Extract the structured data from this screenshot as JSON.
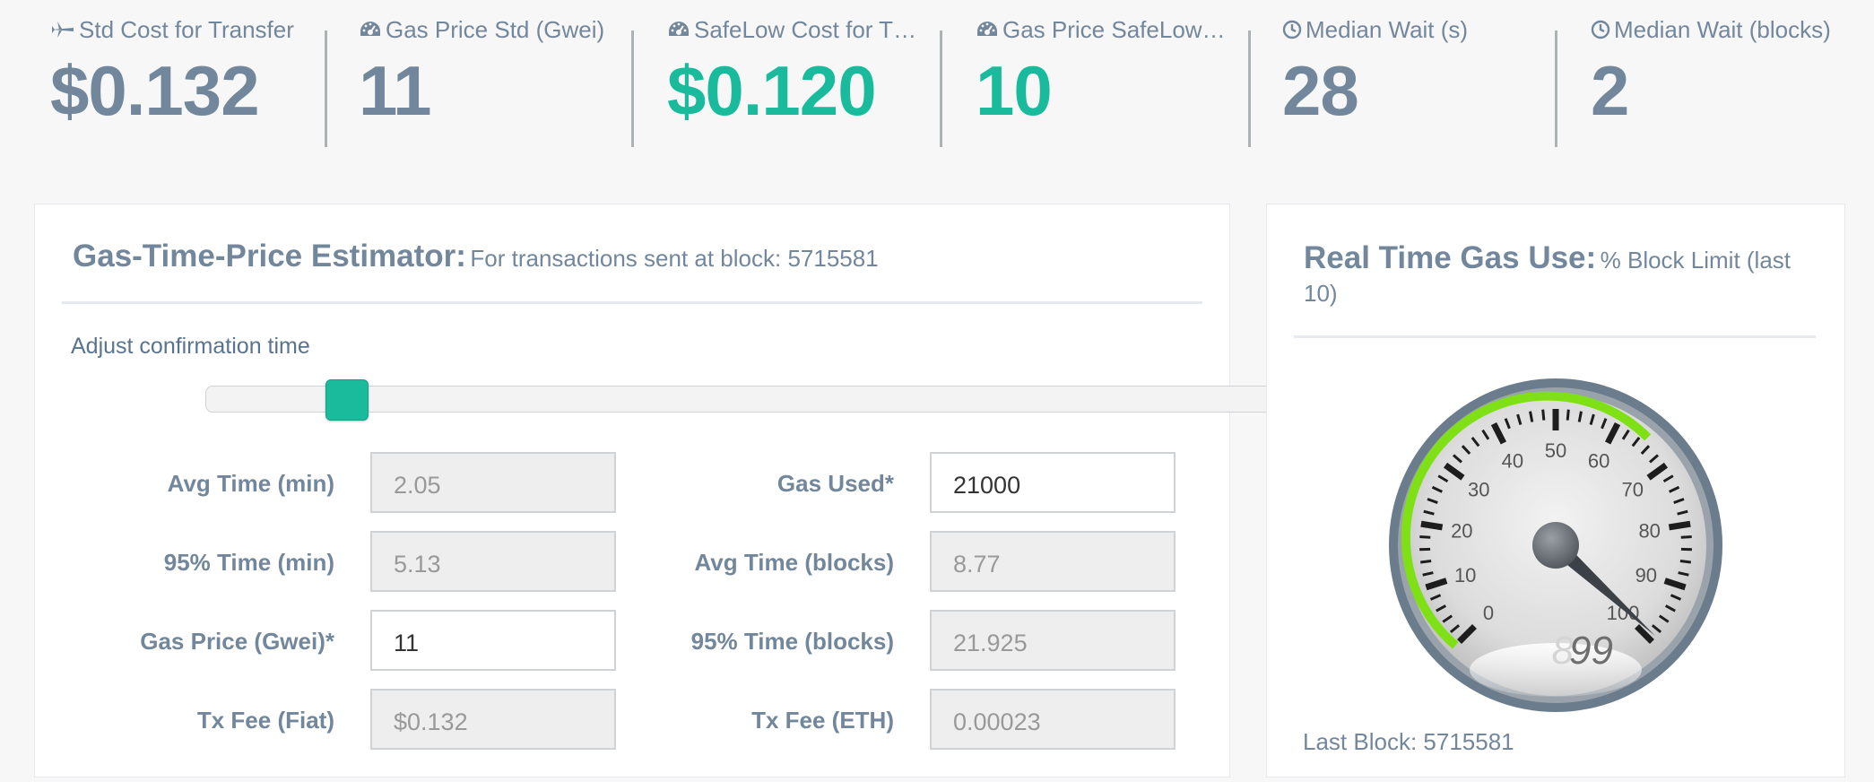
{
  "stats": [
    {
      "icon": "plane-icon",
      "title": "Std Cost for Transfer",
      "value": "$0.132",
      "color": "#73879c"
    },
    {
      "icon": "dashboard-icon",
      "title": "Gas Price Std (Gwei)",
      "value": "11",
      "color": "#73879c"
    },
    {
      "icon": "dashboard-icon",
      "title": "SafeLow Cost for T…",
      "value": "$0.120",
      "color": "#1abb9c"
    },
    {
      "icon": "dashboard-icon",
      "title": "Gas Price SafeLow…",
      "value": "10",
      "color": "#1abb9c"
    },
    {
      "icon": "clock-icon",
      "title": "Median Wait (s)",
      "value": "28",
      "color": "#73879c"
    },
    {
      "icon": "clock-icon",
      "title": "Median Wait (blocks)",
      "value": "2",
      "color": "#73879c"
    }
  ],
  "estimator": {
    "title": "Gas-Time-Price Estimator:",
    "subtitle": "For transactions sent at block: 5715581",
    "adjust_label": "Adjust confirmation time",
    "fields": [
      {
        "label": "Avg Time (min)",
        "value": "2.05",
        "editable": false
      },
      {
        "label": "95% Time (min)",
        "value": "5.13",
        "editable": false
      },
      {
        "label": "Gas Price (Gwei)*",
        "value": "11",
        "editable": true
      },
      {
        "label": "Tx Fee (Fiat)",
        "value": "$0.132",
        "editable": false
      },
      {
        "label": "Gas Used*",
        "value": "21000",
        "editable": true
      },
      {
        "label": "Avg Time (blocks)",
        "value": "8.77",
        "editable": false
      },
      {
        "label": "95% Time (blocks)",
        "value": "21.925",
        "editable": false
      },
      {
        "label": "Tx Fee (ETH)",
        "value": "0.00023",
        "editable": false
      }
    ]
  },
  "gas_use": {
    "title": "Real Time Gas Use:",
    "subtitle_line1": "% Block Limit (last",
    "subtitle_line2": "10)",
    "gauge": {
      "value": 99,
      "display": "99",
      "ticks": [
        "0",
        "10",
        "20",
        "30",
        "40",
        "50",
        "60",
        "70",
        "80",
        "90",
        "100"
      ],
      "accent": "#7fe016"
    },
    "last_block": "Last Block: 5715581"
  }
}
